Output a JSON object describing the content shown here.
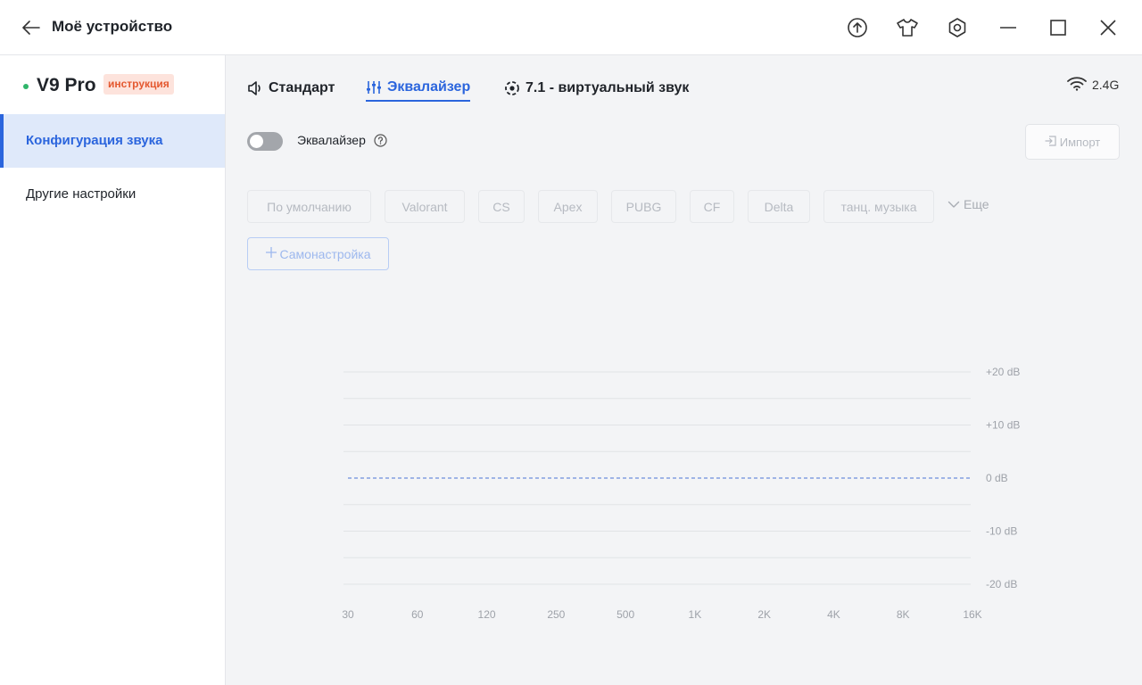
{
  "window": {
    "title": "Моё устройство",
    "icons": [
      "back-arrow-icon",
      "upload-icon",
      "tshirt-icon",
      "settings-hex-icon",
      "minimize-icon",
      "maximize-icon",
      "close-icon"
    ]
  },
  "device": {
    "name": "V9 Pro",
    "badge": "инструкция",
    "status_color": "#2fb56a"
  },
  "sidebar": {
    "items": [
      {
        "label": "Конфигурация звука",
        "active": true
      },
      {
        "label": "Другие настройки",
        "active": false
      }
    ]
  },
  "tabs": [
    {
      "label": "Стандарт",
      "icon": "speaker-icon",
      "active": false
    },
    {
      "label": "Эквалайзер",
      "icon": "equalizer-sliders-icon",
      "active": true
    },
    {
      "label": "7.1 - виртуальный звук",
      "icon": "surround-icon",
      "active": false
    }
  ],
  "connection": {
    "label": "2.4G",
    "icon": "wifi-icon"
  },
  "equalizer": {
    "toggle_label": "Эквалайзер",
    "enabled": false,
    "import_label": "Импорт",
    "presets": [
      "По умолчанию",
      "Valorant",
      "CS",
      "Apex",
      "PUBG",
      "CF",
      "Delta",
      "танц. музыка"
    ],
    "more_label": "Еще",
    "custom_label": "Самонастройка"
  },
  "colors": {
    "accent": "#2b65dd",
    "badge_bg": "#fde3dc",
    "badge_text": "#e4582f"
  },
  "chart_data": {
    "type": "line",
    "x": [
      "30",
      "60",
      "120",
      "250",
      "500",
      "1K",
      "2K",
      "4K",
      "8K",
      "16K"
    ],
    "series": [
      {
        "values": [
          0,
          0,
          0,
          0,
          0,
          0,
          0,
          0,
          0,
          0
        ]
      }
    ],
    "y_ticks": [
      "+20 dB",
      "+10 dB",
      "0 dB",
      "-10 dB",
      "-20 dB"
    ],
    "ylim": [
      -20,
      20
    ],
    "grid": true
  }
}
